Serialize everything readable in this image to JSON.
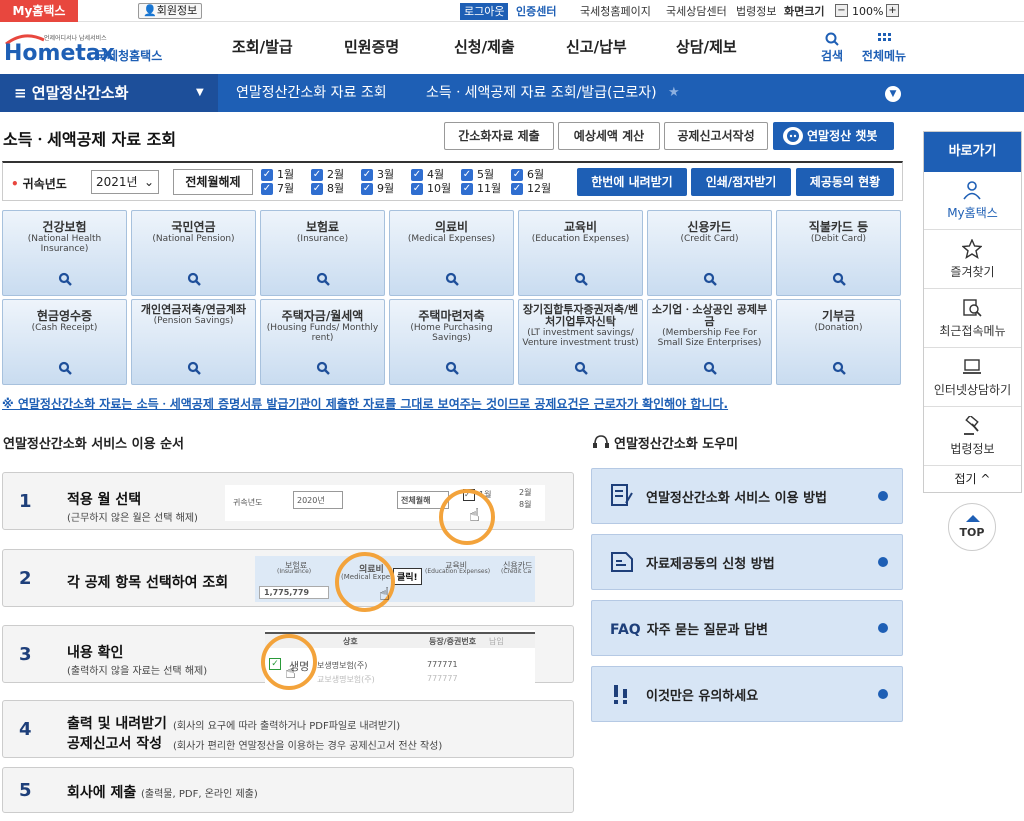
{
  "topbar": {
    "myhometax": "My홈택스",
    "member_info": "회원정보",
    "logout": "로그아웃",
    "cert_center": "인증센터",
    "links": [
      "국세청홈페이지",
      "국세상담센터",
      "법령정보"
    ],
    "screen_size": "화면크기",
    "zoom": "100%"
  },
  "header": {
    "logo_small": "언제어디서나 납세서비스",
    "logo_name": "Hometax",
    "logo_kr": "국세청홈택스",
    "nav": [
      "조회/발급",
      "민원증명",
      "신청/제출",
      "신고/납부",
      "상담/제보"
    ],
    "search": "검색",
    "all_menu": "전체메뉴"
  },
  "breadcrumb": {
    "main": "연말정산간소화",
    "items": [
      "연말정산간소화 자료 조회",
      "소득ㆍ세액공제 자료 조회/발급(근로자)"
    ]
  },
  "page": {
    "title": "소득ㆍ세액공제 자료 조회",
    "buttons": [
      "간소화자료 제출",
      "예상세액 계산",
      "공제신고서작성"
    ],
    "chatbot": "연말정산 챗봇"
  },
  "filter": {
    "year_label": "귀속년도",
    "year_value": "2021년",
    "deselect_all": "전체월해제",
    "months": [
      "1월",
      "2월",
      "3월",
      "4월",
      "5월",
      "6월",
      "7월",
      "8월",
      "9월",
      "10월",
      "11월",
      "12월"
    ],
    "actions": [
      "한번에 내려받기",
      "인쇄/점자받기",
      "제공동의 현황"
    ]
  },
  "tiles": [
    {
      "name": "건강보험",
      "eng": "(National Health Insurance)"
    },
    {
      "name": "국민연금",
      "eng": "(National Pension)"
    },
    {
      "name": "보험료",
      "eng": "(Insurance)"
    },
    {
      "name": "의료비",
      "eng": "(Medical Expenses)"
    },
    {
      "name": "교육비",
      "eng": "(Education Expenses)"
    },
    {
      "name": "신용카드",
      "eng": "(Credit Card)"
    },
    {
      "name": "직불카드 등",
      "eng": "(Debit Card)"
    },
    {
      "name": "현금영수증",
      "eng": "(Cash Receipt)"
    },
    {
      "name": "개인연금저축/연금계좌",
      "eng": "(Pension Savings)"
    },
    {
      "name": "주택자금/월세액",
      "eng": "(Housing Funds/ Monthly rent)"
    },
    {
      "name": "주택마련저축",
      "eng": "(Home Purchasing Savings)"
    },
    {
      "name": "장기집합투자증권저축/벤처기업투자신탁",
      "eng": "(LT investment savings/ Venture investment trust)"
    },
    {
      "name": "소기업ㆍ소상공인 공제부금",
      "eng": "(Membership Fee For Small Size Enterprises)"
    },
    {
      "name": "기부금",
      "eng": "(Donation)"
    }
  ],
  "notice": "※ 연말정산간소화 자료는 소득ㆍ세액공제 증명서류 발급기관이 제출한 자료를 그대로 보여주는 것이므로 공제요건은 근로자가 확인해야 합니다.",
  "order": {
    "heading": "연말정산간소화 서비스 이용 순서",
    "steps": [
      {
        "num": "1",
        "title": "적용 월 선택",
        "desc": "(근무하지 않은 월은 선택 해제)"
      },
      {
        "num": "2",
        "title": "각 공제 항목 선택하여 조회",
        "desc": ""
      },
      {
        "num": "3",
        "title": "내용 확인",
        "desc": "(출력하지 않을 자료는 선택 해제)"
      },
      {
        "num": "4",
        "title": "출력 및 내려받기",
        "title2": "공제신고서 작성",
        "desc": "(회사의 요구에 따라 출력하거나 PDF파일로 내려받기)",
        "desc2": "(회사가 편리한 연말정산을 이용하는 경우 공제신고서 전산 작성)"
      },
      {
        "num": "5",
        "title": "회사에 제출",
        "desc": "(출력물, PDF, 온라인 제출)"
      }
    ],
    "illus1": {
      "year_label": "귀속년도",
      "year_value": "2020년",
      "deselect": "전체월해",
      "m1": "1월",
      "m2": "2월",
      "m8": "8월"
    },
    "illus2": {
      "t1": "보험료",
      "t1e": "(Insurance)",
      "val": "1,775,779",
      "t2": "의료비",
      "t2e": "(Medical Expen",
      "click": "클릭!",
      "t3": "교육비",
      "t3e": "(Education Expenses)",
      "t4": "신용카드",
      "t4e": "(Credit Ca"
    },
    "illus3": {
      "col1": "상호",
      "col2": "등장/증권번호",
      "col3": "납입",
      "name_label": "생명",
      "row1": "보생명보험(주)",
      "row1v": "777771",
      "row2": "교보생명보험(주)",
      "row2v": "777777"
    }
  },
  "helper": {
    "heading": "연말정산간소화 도우미",
    "items": [
      "연말정산간소화 서비스 이용 방법",
      "자료제공동의 신청 방법",
      "자주 묻는 질문과 답변",
      "이것만은 유의하세요"
    ],
    "faq_prefix": "FAQ"
  },
  "quick": {
    "heading": "바로가기",
    "items": [
      "My홈택스",
      "즐겨찾기",
      "최근접속메뉴",
      "인터넷상담하기",
      "법령정보"
    ],
    "fold": "접기 ^",
    "top": "TOP"
  },
  "colors": {
    "brand_blue": "#1e5fb5",
    "accent_red": "#e8473e",
    "highlight_orange": "#f3a33b",
    "tile_bg": "#c9dcf0"
  }
}
